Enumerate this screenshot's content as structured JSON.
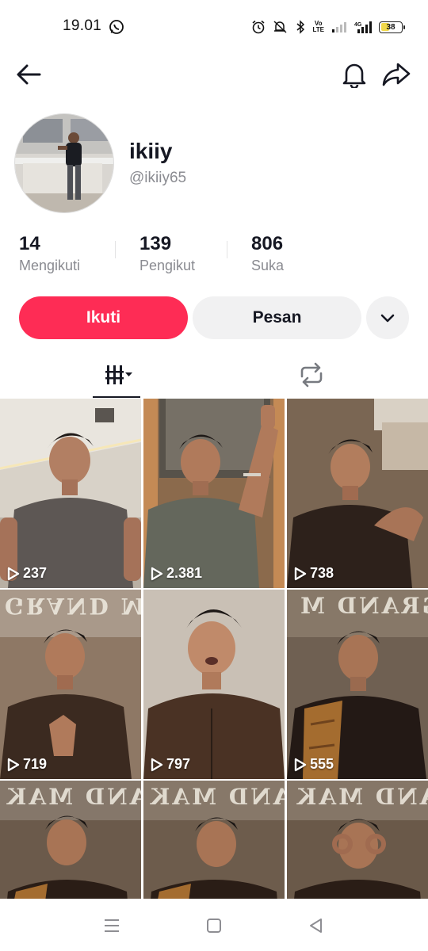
{
  "status_bar": {
    "time": "19.01",
    "network": "4G",
    "battery_level": "38",
    "volte": "Vo\nLTE"
  },
  "header": {
    "back_icon": "arrow-left-icon",
    "bell_icon": "bell-icon",
    "share_icon": "share-icon"
  },
  "profile": {
    "name": "ikiiy",
    "handle": "@ikiiy65"
  },
  "stats": [
    {
      "value": "14",
      "label": "Mengikuti"
    },
    {
      "value": "139",
      "label": "Pengikut"
    },
    {
      "value": "806",
      "label": "Suka"
    }
  ],
  "actions": {
    "follow_label": "Ikuti",
    "message_label": "Pesan",
    "more_icon": "chevron-down-icon"
  },
  "colors": {
    "follow_bg": "#fe2c55",
    "secondary_bg": "#f1f1f2"
  },
  "tabs": [
    {
      "icon": "grid-videos-icon",
      "active": true
    },
    {
      "icon": "repost-icon",
      "active": false
    }
  ],
  "videos": [
    {
      "views": "237"
    },
    {
      "views": "2.381"
    },
    {
      "views": "738"
    },
    {
      "views": "719"
    },
    {
      "views": "797"
    },
    {
      "views": "555"
    },
    {
      "views": ""
    },
    {
      "views": ""
    },
    {
      "views": ""
    }
  ],
  "overlay_texts": {
    "grand_1": "GRAND MAK",
    "grand_2": "GRAND M"
  },
  "nav": {
    "menu_icon": "menu-icon",
    "home_icon": "square-home-icon",
    "back_icon": "triangle-back-icon"
  }
}
